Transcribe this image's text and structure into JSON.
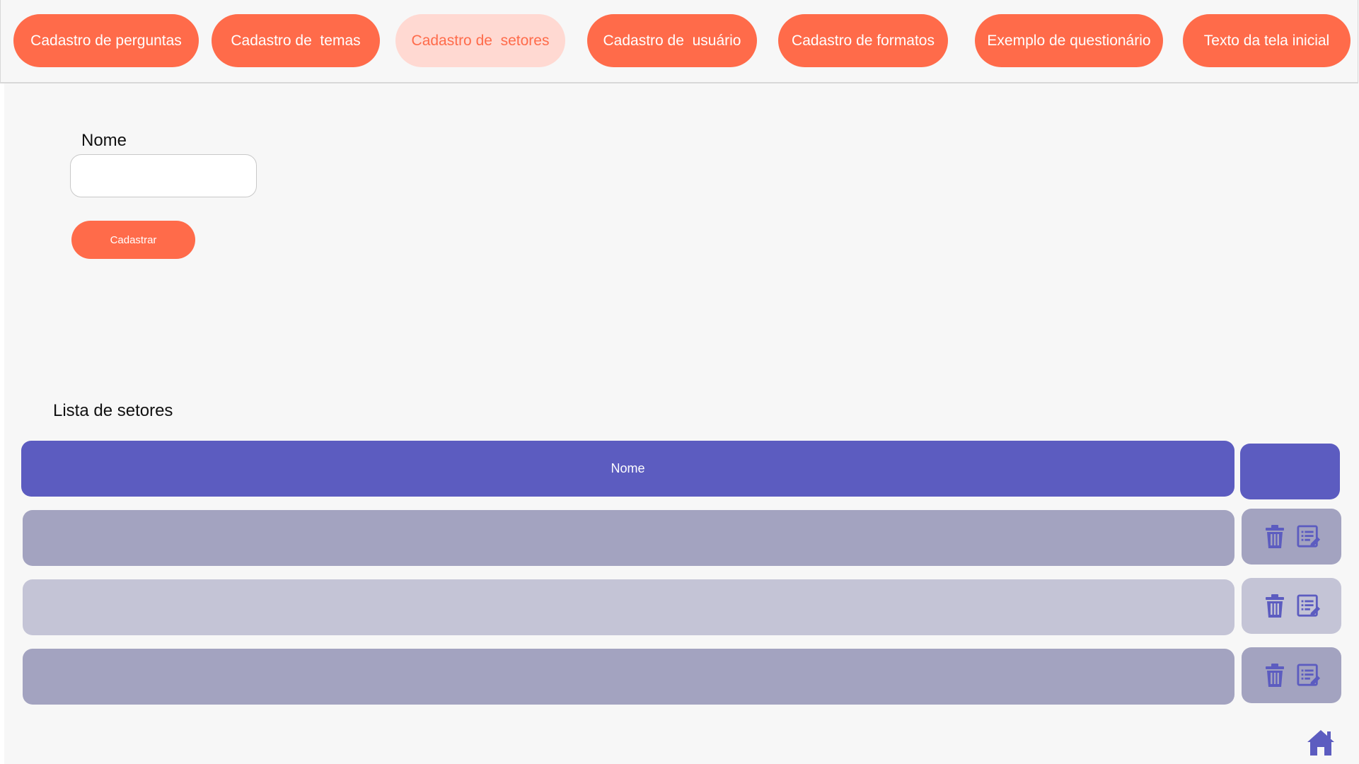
{
  "nav": {
    "items": [
      {
        "label": "Cadastro de perguntas",
        "active": false
      },
      {
        "label": "Cadastro de  temas",
        "active": false
      },
      {
        "label": "Cadastro de  setores",
        "active": true
      },
      {
        "label": "Cadastro de  usuário",
        "active": false
      },
      {
        "label": "Cadastro de formatos",
        "active": false
      },
      {
        "label": "Exemplo de questionário",
        "active": false
      },
      {
        "label": "Texto da tela inicial",
        "active": false
      }
    ]
  },
  "form": {
    "name_label": "Nome",
    "name_value": "",
    "submit_label": "Cadastrar"
  },
  "list": {
    "title": "Lista de setores",
    "header": {
      "name": "Nome"
    },
    "rows": [
      {
        "name": "",
        "shade": "dark"
      },
      {
        "name": "",
        "shade": "light"
      },
      {
        "name": "",
        "shade": "dark"
      }
    ],
    "row_icons": [
      "trash-icon",
      "edit-list-icon"
    ]
  },
  "colors": {
    "accent": "#ff6b4a",
    "accent_light": "#ffd9d2",
    "table_header": "#5c5cc0",
    "row_dark": "#a3a3c0",
    "row_light": "#c4c4d6",
    "icon": "#5c5cc0",
    "background": "#f7f7f7"
  },
  "footer": {
    "icon": "home-icon"
  }
}
